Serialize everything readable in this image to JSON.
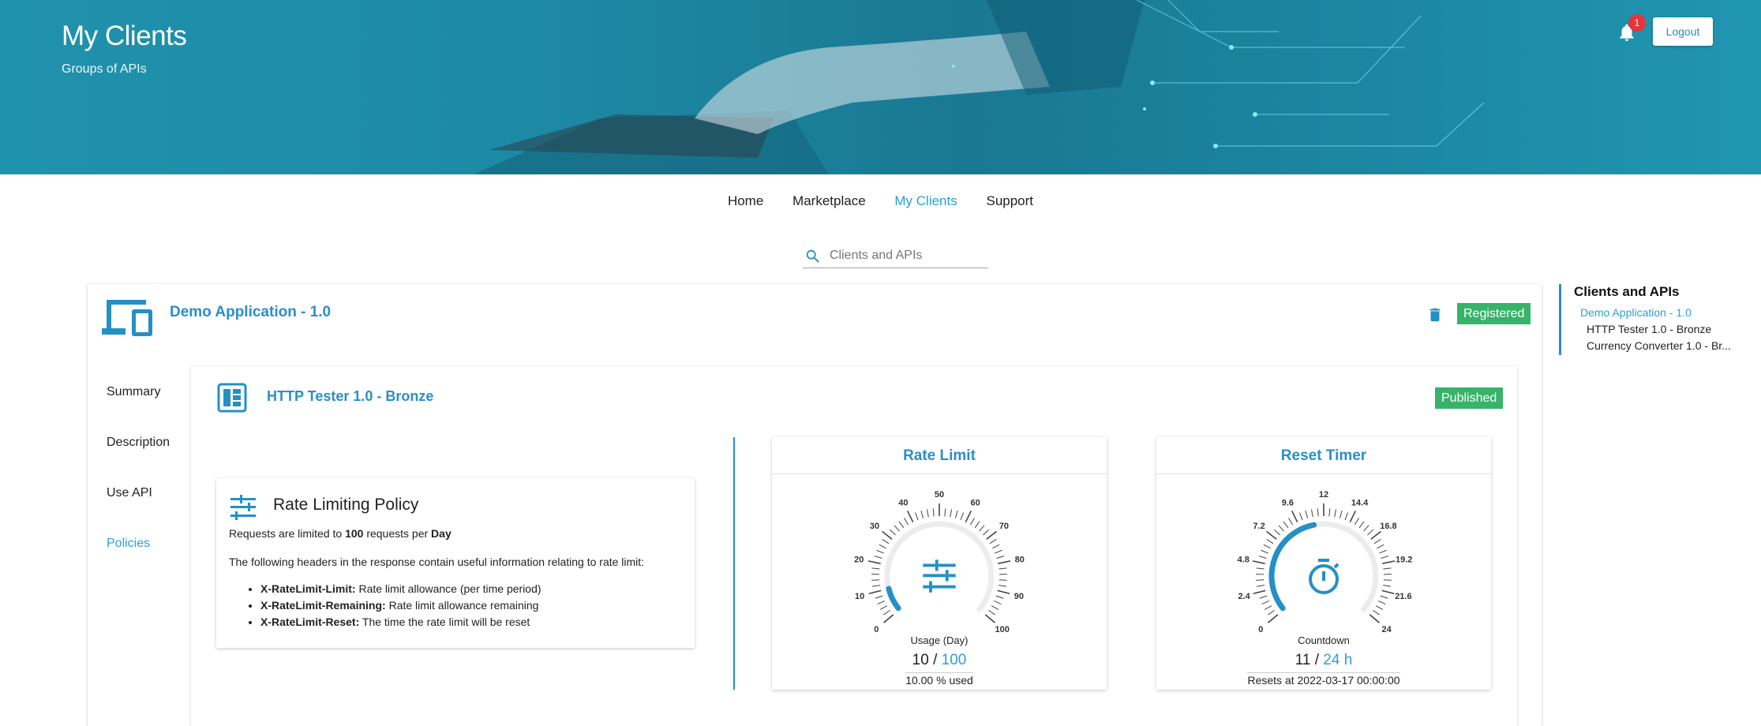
{
  "hero": {
    "title": "My Clients",
    "subtitle": "Groups of APIs",
    "notification_count": "1",
    "logout_label": "Logout"
  },
  "nav": {
    "items": [
      "Home",
      "Marketplace",
      "My Clients",
      "Support"
    ],
    "active": "My Clients"
  },
  "search": {
    "placeholder": "Clients and APIs"
  },
  "client": {
    "title": "Demo Application - 1.0",
    "status": "Registered"
  },
  "sidenav": [
    "Summary",
    "Description",
    "Use API",
    "Policies"
  ],
  "api": {
    "title": "HTTP Tester 1.0 - Bronze",
    "status": "Published"
  },
  "policy": {
    "title": "Rate Limiting Policy",
    "line1_prefix": "Requests are limited to ",
    "line1_limit": "100",
    "line1_mid": " requests per ",
    "line1_period": "Day",
    "line2": "The following headers in the response contain useful information relating to rate limit:",
    "headers": [
      {
        "name": "X-RateLimit-Limit:",
        "desc": " Rate limit allowance (per time period)"
      },
      {
        "name": "X-RateLimit-Remaining:",
        "desc": " Rate limit allowance remaining"
      },
      {
        "name": "X-RateLimit-Reset:",
        "desc": " The time the rate limit will be reset"
      }
    ]
  },
  "rate_gauge": {
    "title": "Rate Limit",
    "ticks": [
      "0",
      "10",
      "20",
      "30",
      "40",
      "50",
      "60",
      "70",
      "80",
      "90",
      "100"
    ],
    "min": 0,
    "max": 100,
    "value": 10,
    "caption": "Usage (Day)",
    "value_text": "10",
    "sep": " / ",
    "max_text": "100",
    "foot": "10.00 % used",
    "accent": "#2390c6"
  },
  "reset_gauge": {
    "title": "Reset Timer",
    "ticks": [
      "0",
      "2.4",
      "4.8",
      "7.2",
      "9.6",
      "12",
      "14.4",
      "16.8",
      "19.2",
      "21.6",
      "24"
    ],
    "min": 0,
    "max": 24,
    "value": 11,
    "caption": "Countdown",
    "value_text": "11",
    "sep": " / ",
    "max_text": "24 h",
    "foot": "Resets at 2022-03-17 00:00:00",
    "accent": "#2390c6"
  },
  "toc": {
    "title": "Clients and APIs",
    "items": [
      "Demo Application - 1.0",
      "HTTP Tester 1.0 - Bronze",
      "Currency Converter 1.0 - Br..."
    ]
  }
}
